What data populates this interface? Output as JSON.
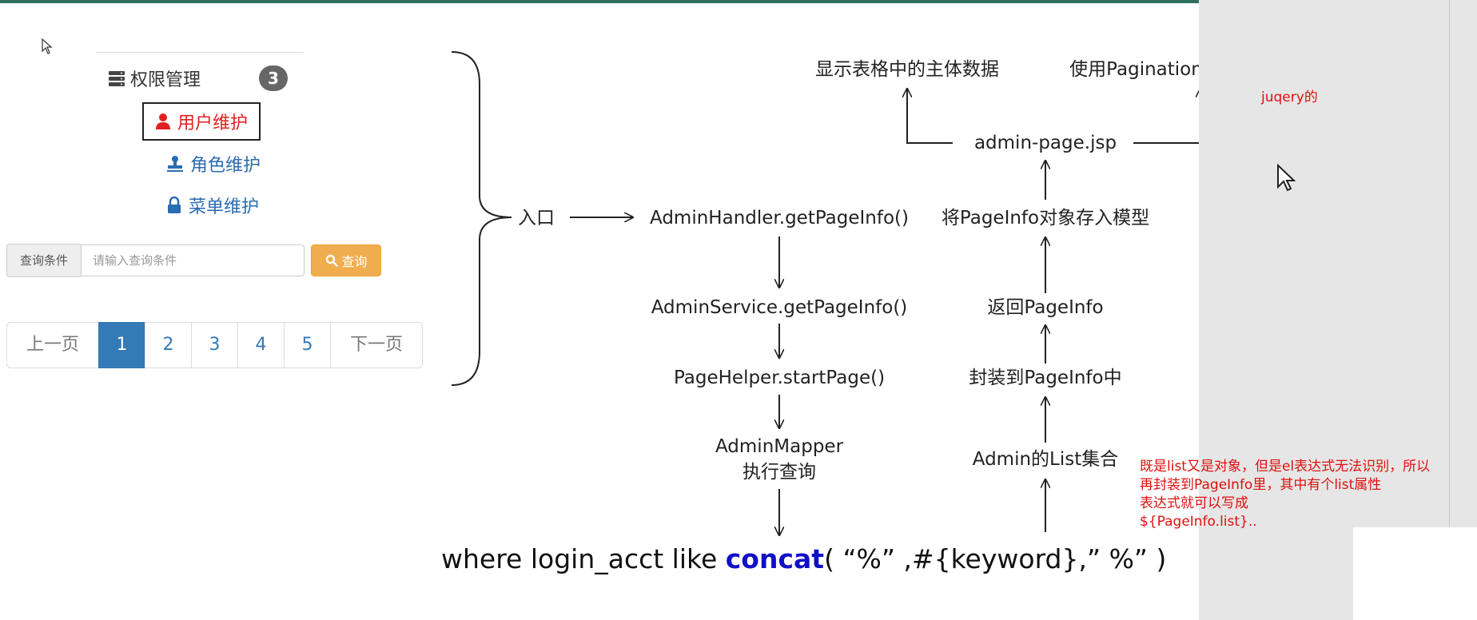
{
  "colors": {
    "accent_red": "#e01010",
    "link_blue": "#337ab7",
    "keyword_blue": "#1010c8",
    "warning_orange": "#f0ad4e"
  },
  "ui_mock": {
    "menu_header": {
      "icon": "server-icon",
      "label": "权限管理",
      "badge": "3"
    },
    "menu_items": [
      {
        "icon": "user-icon",
        "label": "用户维护",
        "active": true
      },
      {
        "icon": "stamp-icon",
        "label": "角色维护",
        "active": false
      },
      {
        "icon": "lock-icon",
        "label": "菜单维护",
        "active": false
      }
    ],
    "search": {
      "label": "查询条件",
      "placeholder": "请输入查询条件",
      "button": "查询",
      "button_icon": "search-icon"
    },
    "pagination": {
      "prev": "上一页",
      "pages": [
        "1",
        "2",
        "3",
        "4",
        "5"
      ],
      "active_page": "1",
      "next": "下一页"
    }
  },
  "diagram": {
    "entry": "入口",
    "flow_down": [
      "AdminHandler.getPageInfo()",
      "AdminService.getPageInfo()",
      "PageHelper.startPage()",
      "AdminMapper",
      "执行查询"
    ],
    "flow_up": [
      "Admin的List集合",
      "封装到PageInfo中",
      "返回PageInfo",
      "将PageInfo对象存入模型",
      "admin-page.jsp"
    ],
    "outputs": [
      "显示表格中的主体数据",
      "使用Pagination显示页面导航条"
    ],
    "sql": {
      "prefix": "where login_acct like ",
      "keyword": "concat",
      "suffix": "( “%” ,#{keyword},” %” )"
    }
  },
  "annotations": {
    "jquery_note": "juqery的",
    "list_note": [
      "既是list又是对象，但是el表达式无法识别，所以",
      "再封装到PageInfo里，其中有个list属性",
      "表达式就可以写成",
      "${PageInfo.list}.."
    ]
  }
}
